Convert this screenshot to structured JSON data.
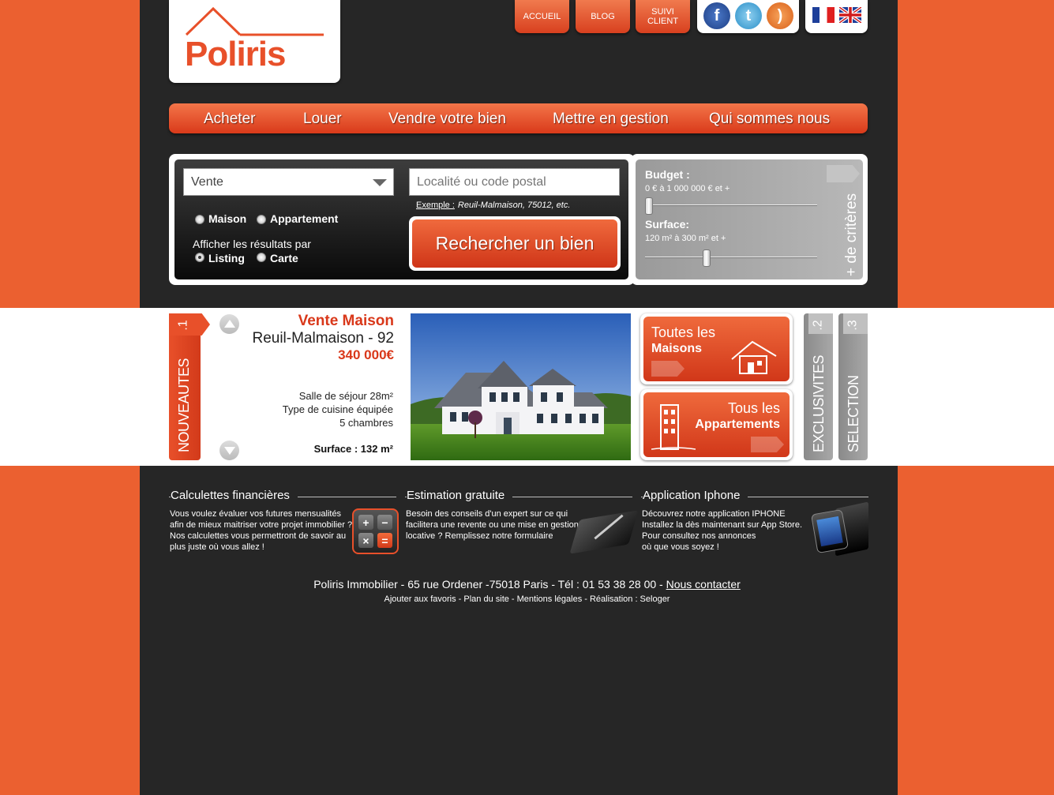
{
  "brand": {
    "name": "Poliris",
    "accent": "#e8502a",
    "background": "#262626",
    "outer": "#eb6030"
  },
  "toptabs": [
    {
      "label": "ACCUEIL"
    },
    {
      "label": "BLOG"
    },
    {
      "label1": "SUIVI",
      "label2": "CLIENT"
    }
  ],
  "social": [
    {
      "icon": "facebook-icon",
      "glyph": "f"
    },
    {
      "icon": "twitter-icon",
      "glyph": "t"
    },
    {
      "icon": "rss-icon",
      "glyph": ")"
    }
  ],
  "languages": [
    {
      "icon": "france-flag-icon"
    },
    {
      "icon": "uk-flag-icon"
    }
  ],
  "nav": [
    {
      "label": "Acheter"
    },
    {
      "label": "Louer"
    },
    {
      "label": "Vendre votre bien"
    },
    {
      "label": "Mettre en gestion"
    },
    {
      "label": "Qui sommes nous"
    }
  ],
  "search": {
    "transaction": "Vente",
    "location_placeholder": "Localité ou code postal",
    "example_label": "Exemple :",
    "example_text": "Reuil-Malmaison, 75012, etc.",
    "types": [
      {
        "label": "Maison",
        "checked": false
      },
      {
        "label": "Appartement",
        "checked": false
      }
    ],
    "display_label": "Afficher les résultats par",
    "displays": [
      {
        "label": "Listing",
        "checked": true
      },
      {
        "label": "Carte",
        "checked": false
      }
    ],
    "button": "Rechercher un bien"
  },
  "criteria": {
    "budget_label": "Budget :",
    "budget_value": "0 € à 1 000 000 € et +",
    "budget_level": 0.0,
    "surface_label": "Surface:",
    "surface_value": "120 m² à 300 m² et +",
    "surface_level": 0.35,
    "more": "+ de critères"
  },
  "featured": {
    "tab_number": ".1",
    "tab_label": "NOUVEAUTES",
    "title": "Vente Maison",
    "location": "Reuil-Malmaison - 92",
    "price": "340 000€",
    "features": [
      "Salle de séjour 28m²",
      "Type de cuisine équipée",
      "5 chambres"
    ],
    "surface": "Surface : 132 m²"
  },
  "categories": [
    {
      "line1": "Toutes les",
      "line2": "Maisons"
    },
    {
      "line1": "Tous les",
      "line2": "Appartements"
    }
  ],
  "sidetabs": [
    {
      "number": ".2",
      "label": "EXCLUSIVITES"
    },
    {
      "number": ".3",
      "label": "SELECTION"
    }
  ],
  "footer_cols": [
    {
      "title": "Calculettes financières",
      "lines": [
        "Vous voulez évaluer vos futures mensualités",
        "afin de mieux maitriser votre projet immobilier ?",
        "Nos calculettes vous permettront de savoir au",
        "plus juste où vous allez !"
      ]
    },
    {
      "title": "Estimation gratuite",
      "lines": [
        "Besoin des conseils d'un expert sur ce qui",
        "facilitera une revente ou une mise en gestion",
        "locative ? Remplissez notre formulaire"
      ]
    },
    {
      "title": "Application Iphone",
      "lines": [
        "Découvrez notre application IPHONE",
        "Installez la dès maintenant sur App Store.",
        "Pour consultez nos annonces",
        "où que vous soyez !"
      ]
    }
  ],
  "calc_keys": [
    "+",
    "−",
    "×",
    "="
  ],
  "footer": {
    "address": "Poliris Immobilier - 65 rue Ordener -75018 Paris - Tél : 01 53 38 28 00 - ",
    "contact": "Nous contacter",
    "links": "Ajouter aux favoris - Plan du site - Mentions légales - Réalisation : Seloger"
  }
}
